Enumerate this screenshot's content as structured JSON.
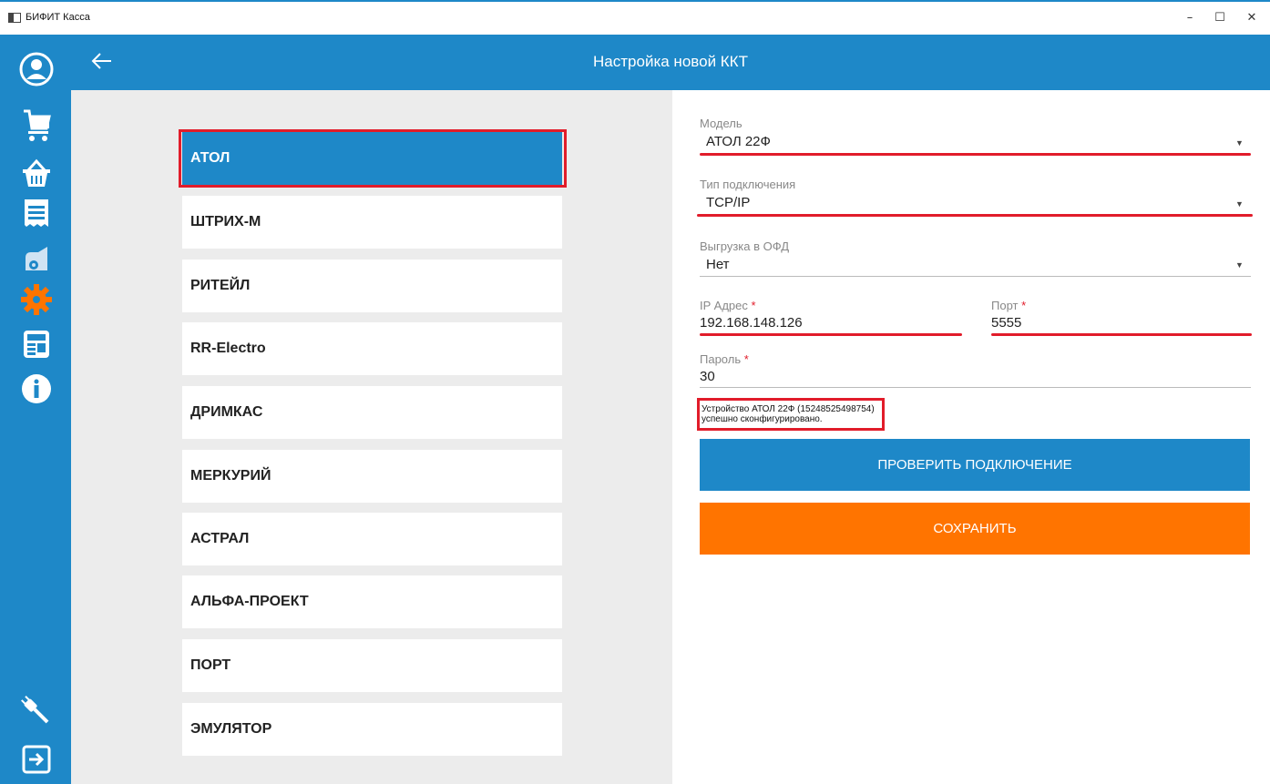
{
  "window": {
    "title": "БИФИТ Касса",
    "minimize": "–",
    "maximize": "☐",
    "close": "✕"
  },
  "header": {
    "title": "Настройка новой ККТ"
  },
  "vendors": [
    {
      "label": "АТОЛ",
      "active": true
    },
    {
      "label": "ШТРИХ-М"
    },
    {
      "label": "РИТЕЙЛ"
    },
    {
      "label": "RR-Electro"
    },
    {
      "label": "ДРИМКАС"
    },
    {
      "label": "МЕРКУРИЙ"
    },
    {
      "label": "АСТРАЛ"
    },
    {
      "label": "АЛЬФА-ПРОЕКТ"
    },
    {
      "label": "ПОРТ"
    },
    {
      "label": "ЭМУЛЯТОР"
    }
  ],
  "form": {
    "model": {
      "label": "Модель",
      "value": "АТОЛ 22Ф"
    },
    "connection": {
      "label": "Тип подключения",
      "value": "TCP/IP"
    },
    "ofd": {
      "label": "Выгрузка в ОФД",
      "value": "Нет"
    },
    "ip": {
      "label": "IP Адрес",
      "value": "192.168.148.126"
    },
    "port": {
      "label": "Порт",
      "value": "5555"
    },
    "password": {
      "label": "Пароль",
      "value": "30"
    },
    "required_mark": "*",
    "status_line1": "Устройство АТОЛ 22Ф (15248525498754)",
    "status_line2": "успешно сконфигурировано.",
    "check_button": "ПРОВЕРИТЬ ПОДКЛЮЧЕНИЕ",
    "save_button": "СОХРАНИТЬ"
  },
  "colors": {
    "primary": "#1e88c8",
    "accent": "#ff7400",
    "highlight": "#e11c2a"
  },
  "sidebar_icons": [
    "user-icon",
    "cart-icon",
    "basket-icon",
    "receipt-icon",
    "reports-icon",
    "settings-icon",
    "news-icon",
    "info-icon",
    "plug-icon",
    "logout-icon"
  ]
}
